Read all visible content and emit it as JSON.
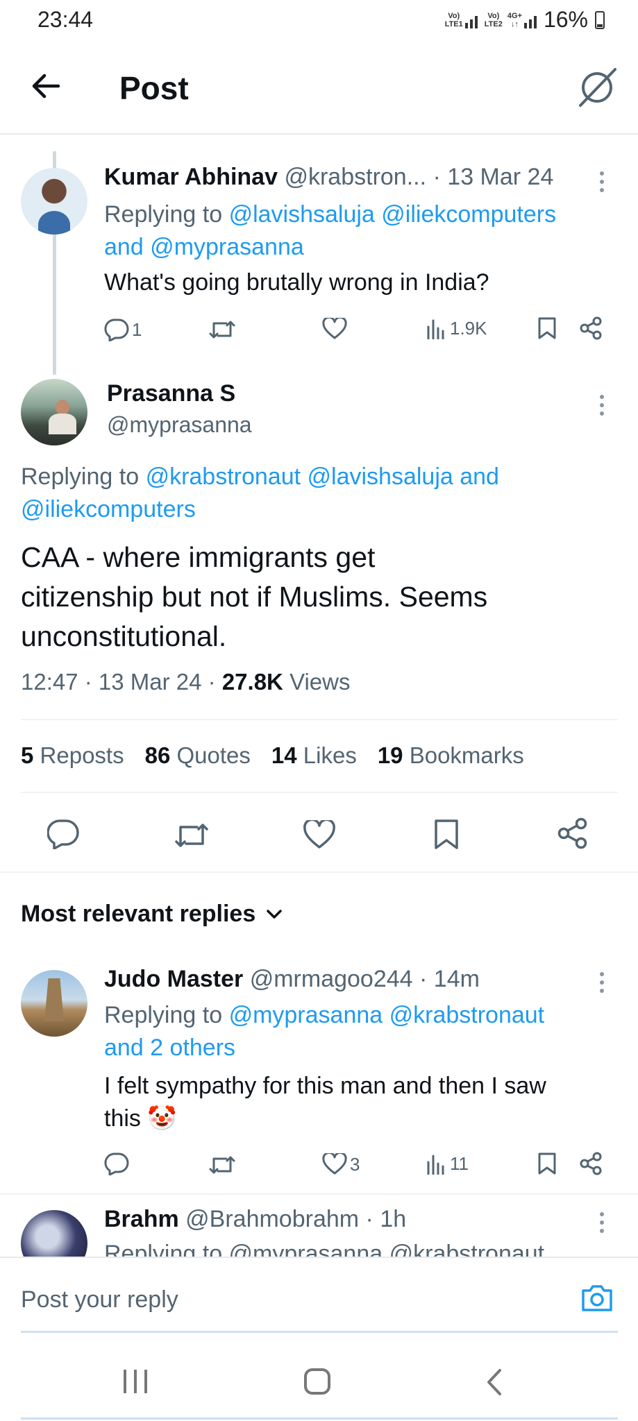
{
  "status_bar": {
    "time": "23:44",
    "sim1": "LTE1",
    "sim2": "LTE2",
    "network": "4G+",
    "battery": "16%"
  },
  "header": {
    "title": "Post",
    "back_icon": "arrow-left-icon",
    "grok_icon": "slash-circle-icon"
  },
  "parent_reply": {
    "name": "Kumar Abhinav",
    "handle": "@krabstron...",
    "date": "· 13 Mar 24",
    "replying_prefix": "Replying to",
    "replying_mentions": "@lavishsaluja @iliekcomputers",
    "replying_line2": "and @myprasanna",
    "text": "What's going brutally wrong in India?",
    "replies": "1",
    "views": "1.9K"
  },
  "main_post": {
    "name": "Prasanna S",
    "handle": "@myprasanna",
    "replying_prefix": "Replying to",
    "replying_line1": "@krabstronaut @lavishsaluja and",
    "replying_line2": "@iliekcomputers",
    "text_line1": "CAA - where immigrants get",
    "text_line2": "citizenship but not if Muslims. Seems",
    "text_line3": "unconstitutional.",
    "time_date": "12:47 · 13 Mar 24 ·",
    "views_count": "27.8K",
    "views_label": "Views",
    "stats": [
      {
        "count": "5",
        "label": "Reposts"
      },
      {
        "count": "86",
        "label": "Quotes"
      },
      {
        "count": "14",
        "label": "Likes"
      },
      {
        "count": "19",
        "label": "Bookmarks"
      }
    ]
  },
  "replies_header": {
    "label": "Most relevant replies"
  },
  "reply1": {
    "name": "Judo Master",
    "handle": "@mrmagoo244",
    "time": "· 14m",
    "replying_prefix": "Replying to",
    "replying_mentions": "@myprasanna @krabstronaut",
    "replying_line2": "and 2 others",
    "text_line1": "I felt sympathy for this man and then I saw",
    "text_line2": "this",
    "emoji": "🤡",
    "likes": "3",
    "views": "11"
  },
  "reply2": {
    "name": "Brahm",
    "handle": "@Brahmobrahm",
    "time": "· 1h",
    "replying_partial": "Replying to @myprasanna @krabstronaut"
  },
  "composer": {
    "placeholder": "Post your reply"
  },
  "colors": {
    "link": "#1d9bf0",
    "muted": "#536471",
    "text": "#0f1419",
    "divider": "#eff3f4"
  }
}
